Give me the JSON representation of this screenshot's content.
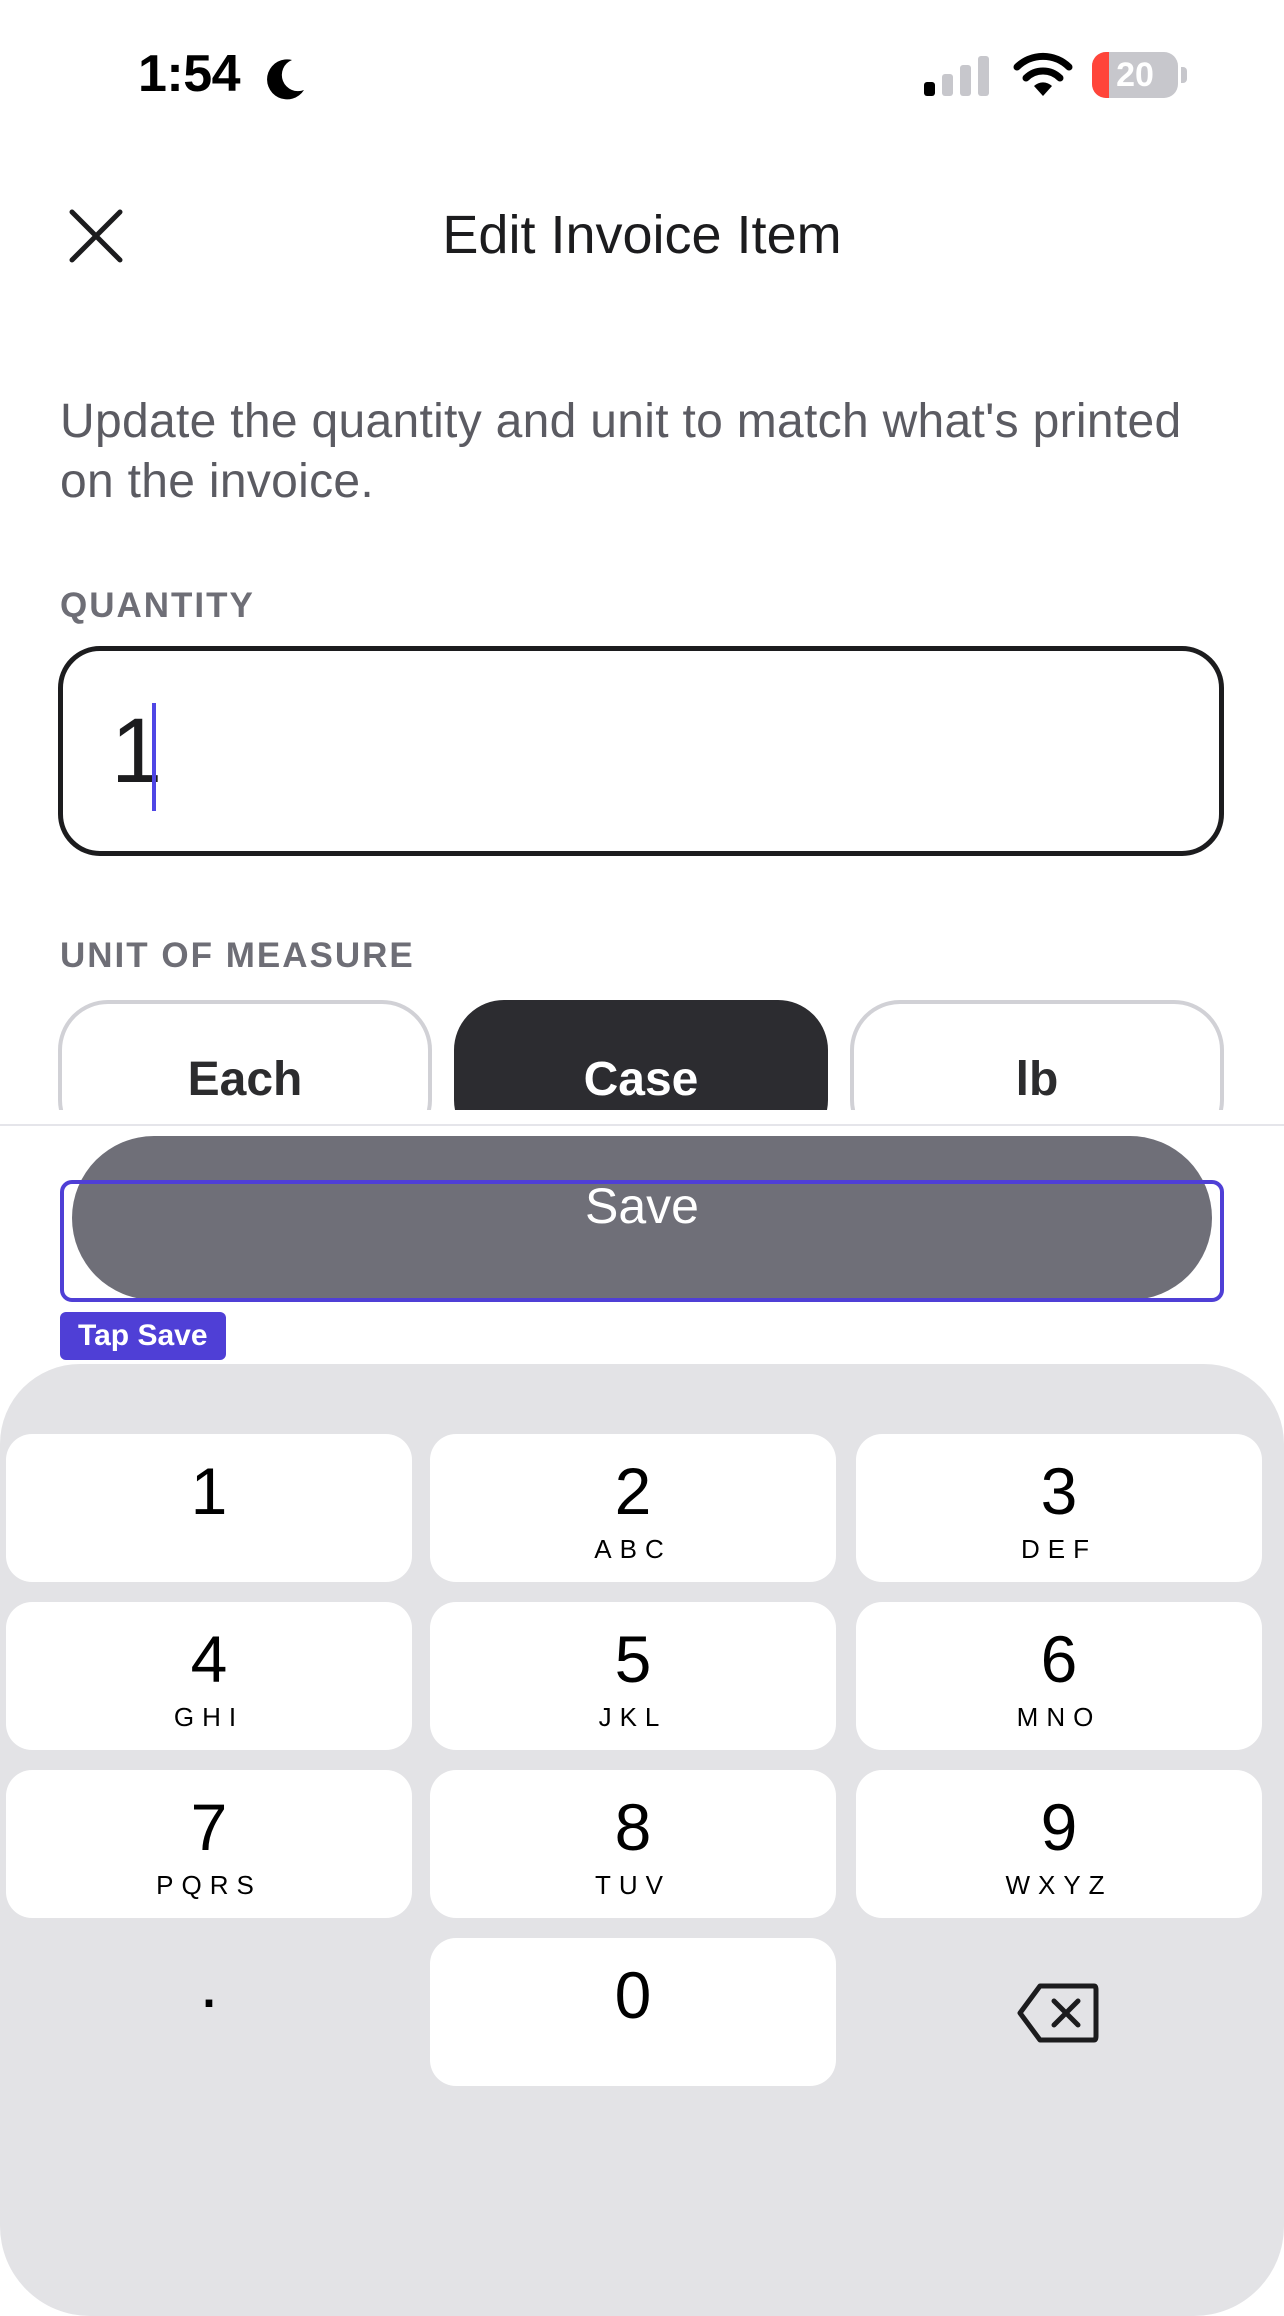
{
  "status_bar": {
    "time": "1:54",
    "moon_icon": "moon-icon",
    "signal_icon": "cellular-signal-icon",
    "wifi_icon": "wifi-icon",
    "battery_level": "20",
    "battery_color": "#ff453a"
  },
  "header": {
    "title": "Edit Invoice Item",
    "close_icon": "close-icon"
  },
  "description": "Update the quantity and unit to match what's printed on the invoice.",
  "quantity": {
    "label": "QUANTITY",
    "value": "1"
  },
  "unit_of_measure": {
    "label": "UNIT OF MEASURE",
    "options": [
      "Each",
      "Case",
      "lb"
    ],
    "selected": "Case"
  },
  "save_button": {
    "label": "Save"
  },
  "annotation": {
    "tag": "Tap Save",
    "color": "#4f3fd6"
  },
  "keypad": {
    "keys": [
      {
        "digit": "1",
        "letters": ""
      },
      {
        "digit": "2",
        "letters": "ABC"
      },
      {
        "digit": "3",
        "letters": "DEF"
      },
      {
        "digit": "4",
        "letters": "GHI"
      },
      {
        "digit": "5",
        "letters": "JKL"
      },
      {
        "digit": "6",
        "letters": "MNO"
      },
      {
        "digit": "7",
        "letters": "PQRS"
      },
      {
        "digit": "8",
        "letters": "TUV"
      },
      {
        "digit": "9",
        "letters": "WXYZ"
      },
      {
        "digit": "0",
        "letters": ""
      }
    ],
    "decimal": ".",
    "backspace_icon": "backspace-icon"
  }
}
